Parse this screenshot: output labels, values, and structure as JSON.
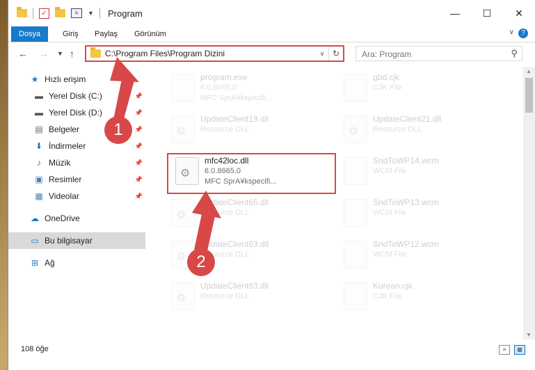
{
  "window": {
    "title": "Program",
    "minimize": "—",
    "maximize": "☐",
    "close": "✕"
  },
  "ribbon": {
    "tabs": [
      "Dosya",
      "Giriş",
      "Paylaş",
      "Görünüm"
    ],
    "help": "?"
  },
  "address": {
    "path": "C:\\Program Files\\Program Dizini",
    "search_placeholder": "Ara: Program"
  },
  "nav": {
    "items": [
      {
        "label": "Hızlı erişim",
        "icon": "star-icon",
        "pinned": false
      },
      {
        "label": "Yerel Disk (C:)",
        "icon": "disk-icon",
        "pinned": true
      },
      {
        "label": "Yerel Disk (D:)",
        "icon": "disk-icon",
        "pinned": true
      },
      {
        "label": "Belgeler",
        "icon": "document-icon",
        "pinned": true
      },
      {
        "label": "İndirmeler",
        "icon": "download-icon",
        "pinned": true
      },
      {
        "label": "Müzik",
        "icon": "music-icon",
        "pinned": true
      },
      {
        "label": "Resimler",
        "icon": "pictures-icon",
        "pinned": true
      },
      {
        "label": "Videolar",
        "icon": "video-icon",
        "pinned": true
      },
      {
        "label": "OneDrive",
        "icon": "cloud-icon",
        "pinned": false
      },
      {
        "label": "Bu bilgisayar",
        "icon": "computer-icon",
        "pinned": false,
        "selected": true
      },
      {
        "label": "Ağ",
        "icon": "network-icon",
        "pinned": false
      }
    ]
  },
  "files": {
    "left": [
      {
        "name": "program.exe",
        "line2": "6.0.8665.0",
        "line3": "MFC SprA¥kspecifi...",
        "faded": true
      },
      {
        "name": "UpdateClient19.dll",
        "line2": "Resource DLL",
        "line3": "",
        "faded": true
      },
      {
        "name": "mfc42loc.dll",
        "line2": "6.0.8665.0",
        "line3": "MFC SprA¥kspecifi...",
        "faded": false,
        "highlight": true
      },
      {
        "name": "UpdateClient65.dll",
        "line2": "Resource DLL",
        "line3": "",
        "faded": true
      },
      {
        "name": "UpdateClient63.dll",
        "line2": "Resource DLL",
        "line3": "",
        "faded": true
      },
      {
        "name": "UpdateClient63.dll",
        "line2": "Resource DLL",
        "line3": "",
        "faded": true
      }
    ],
    "right": [
      {
        "name": "gbd.cjk",
        "line2": "CJK File",
        "faded": true
      },
      {
        "name": "UpdateClient21.dll",
        "line2": "Resource DLL",
        "faded": true
      },
      {
        "name": "SndToWP14.wcm",
        "line2": "WCM File",
        "faded": true
      },
      {
        "name": "SndToWP13.wcm",
        "line2": "WCM File",
        "faded": true
      },
      {
        "name": "SndToWP12.wcm",
        "line2": "WCM File",
        "faded": true
      },
      {
        "name": "Korean.cjk",
        "line2": "CJK File",
        "faded": true
      }
    ]
  },
  "status": {
    "item_count": "108 öğe"
  },
  "annotations": [
    "1",
    "2"
  ],
  "colors": {
    "accent": "#1979ca",
    "highlight_red": "#d84848"
  }
}
